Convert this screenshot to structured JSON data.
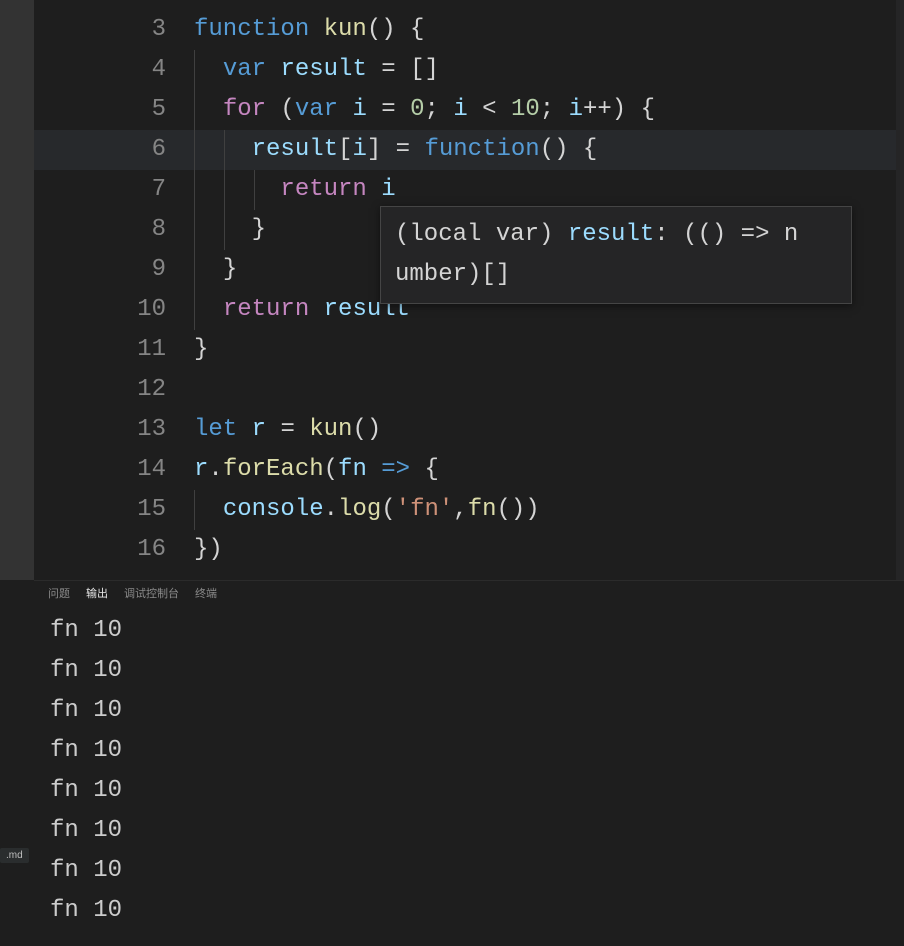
{
  "editor": {
    "lines": [
      {
        "num": "3",
        "indent": 0,
        "tokens": [
          [
            "kw",
            "function"
          ],
          [
            "punc",
            " "
          ],
          [
            "fn",
            "kun"
          ],
          [
            "punc",
            "() {"
          ]
        ]
      },
      {
        "num": "4",
        "indent": 1,
        "tokens": [
          [
            "kw",
            "var"
          ],
          [
            "punc",
            " "
          ],
          [
            "var",
            "result"
          ],
          [
            "punc",
            " "
          ],
          [
            "op",
            "="
          ],
          [
            "punc",
            " []"
          ]
        ]
      },
      {
        "num": "5",
        "indent": 1,
        "tokens": [
          [
            "kw2",
            "for"
          ],
          [
            "punc",
            " ("
          ],
          [
            "kw",
            "var"
          ],
          [
            "punc",
            " "
          ],
          [
            "var",
            "i"
          ],
          [
            "punc",
            " "
          ],
          [
            "op",
            "="
          ],
          [
            "punc",
            " "
          ],
          [
            "num",
            "0"
          ],
          [
            "punc",
            "; "
          ],
          [
            "var",
            "i"
          ],
          [
            "punc",
            " "
          ],
          [
            "op",
            "<"
          ],
          [
            "punc",
            " "
          ],
          [
            "num",
            "10"
          ],
          [
            "punc",
            "; "
          ],
          [
            "var",
            "i"
          ],
          [
            "op",
            "++"
          ],
          [
            "punc",
            ") {"
          ]
        ]
      },
      {
        "num": "6",
        "indent": 2,
        "current": true,
        "tokens": [
          [
            "var",
            "result"
          ],
          [
            "punc",
            "["
          ],
          [
            "var",
            "i"
          ],
          [
            "punc",
            "] "
          ],
          [
            "op",
            "="
          ],
          [
            "punc",
            " "
          ],
          [
            "kw",
            "function"
          ],
          [
            "punc",
            "() {"
          ]
        ]
      },
      {
        "num": "7",
        "indent": 3,
        "tokens": [
          [
            "kw2",
            "return"
          ],
          [
            "punc",
            " "
          ],
          [
            "var",
            "i"
          ]
        ]
      },
      {
        "num": "8",
        "indent": 2,
        "tokens": [
          [
            "punc",
            "}"
          ]
        ]
      },
      {
        "num": "9",
        "indent": 1,
        "tokens": [
          [
            "punc",
            "}"
          ]
        ]
      },
      {
        "num": "10",
        "indent": 1,
        "tokens": [
          [
            "kw2",
            "return"
          ],
          [
            "punc",
            " "
          ],
          [
            "var",
            "result"
          ]
        ],
        "hlWord": true
      },
      {
        "num": "11",
        "indent": 0,
        "tokens": [
          [
            "punc",
            "}"
          ]
        ]
      },
      {
        "num": "12",
        "indent": 0,
        "tokens": []
      },
      {
        "num": "13",
        "indent": 0,
        "tokens": [
          [
            "kw",
            "let"
          ],
          [
            "punc",
            " "
          ],
          [
            "var",
            "r"
          ],
          [
            "punc",
            " "
          ],
          [
            "op",
            "="
          ],
          [
            "punc",
            " "
          ],
          [
            "fn",
            "kun"
          ],
          [
            "punc",
            "()"
          ]
        ]
      },
      {
        "num": "14",
        "indent": 0,
        "tokens": [
          [
            "var",
            "r"
          ],
          [
            "punc",
            "."
          ],
          [
            "fn",
            "forEach"
          ],
          [
            "punc",
            "("
          ],
          [
            "var",
            "fn"
          ],
          [
            "punc",
            " "
          ],
          [
            "kw",
            "=>"
          ],
          [
            "punc",
            " {"
          ]
        ]
      },
      {
        "num": "15",
        "indent": 1,
        "tokens": [
          [
            "var",
            "console"
          ],
          [
            "punc",
            "."
          ],
          [
            "fn",
            "log"
          ],
          [
            "punc",
            "("
          ],
          [
            "str",
            "'fn'"
          ],
          [
            "punc",
            ","
          ],
          [
            "fn",
            "fn"
          ],
          [
            "punc",
            "())"
          ]
        ]
      },
      {
        "num": "16",
        "indent": 0,
        "tokens": [
          [
            "punc",
            "})"
          ]
        ]
      }
    ],
    "hover": {
      "line1_prefix": "(local var) ",
      "line1_var": "result",
      "line1_rest": ": (() => n",
      "line2": "umber)[]"
    }
  },
  "panel": {
    "tabs": {
      "problems": "问题",
      "output": "输出",
      "debug": "调试控制台",
      "terminal": "终端"
    },
    "activeTab": "output",
    "outputLines": [
      "fn 10",
      "fn 10",
      "fn 10",
      "fn 10",
      "fn 10",
      "fn 10",
      "fn 10",
      "fn 10"
    ]
  },
  "openFileBadge": ".md"
}
